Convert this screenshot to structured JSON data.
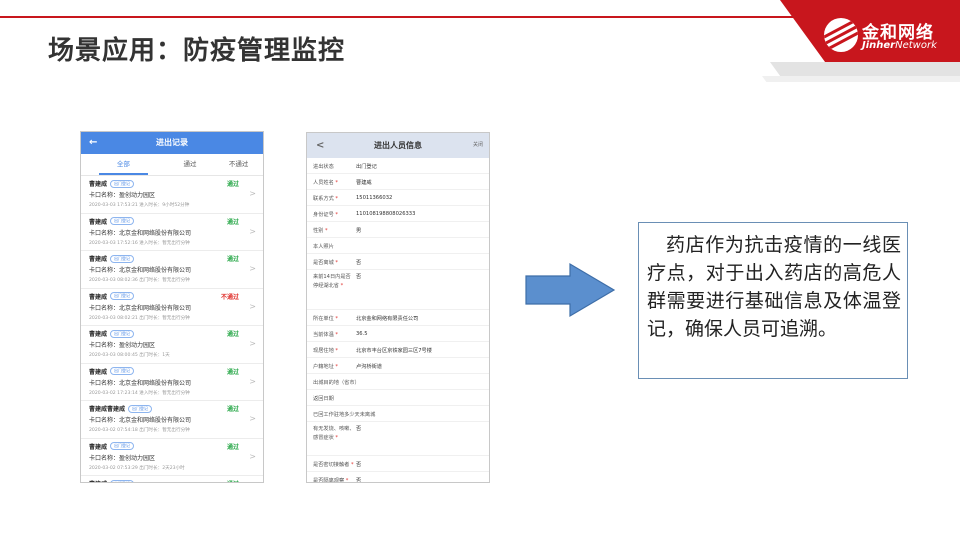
{
  "slide": {
    "title": "场景应用：防疫管理监控",
    "logo_cn": "金和网络",
    "logo_en_bold": "Jinher",
    "logo_en_rest": "Network"
  },
  "records_screen": {
    "title": "进出记录",
    "back": "←",
    "tabs": [
      "全部",
      "通过",
      "不通过"
    ],
    "active_tab": 0,
    "accent": "#4a88e4",
    "records": [
      {
        "name": "曹建威",
        "tag": "出门登记",
        "status": "通过",
        "status_type": "ok",
        "company": "卡口名称：盈创动力园区",
        "meta": "2020-03-03 17:53:21 进入时长：9小时52分钟"
      },
      {
        "name": "曹建威",
        "tag": "出门登记",
        "status": "通过",
        "status_type": "ok",
        "company": "卡口名称：北京金和网络股份有限公司",
        "meta": "2020-03-03 17:52:16 进入时长：暂无出行分钟"
      },
      {
        "name": "曹建威",
        "tag": "出门登记",
        "status": "通过",
        "status_type": "ok",
        "company": "卡口名称：北京金和网络股份有限公司",
        "meta": "2020-03-03 08:02:36 出门时长：暂无出行分钟"
      },
      {
        "name": "曹建威",
        "tag": "出门登记",
        "status": "不通过",
        "status_type": "no",
        "company": "卡口名称：北京金和网络股份有限公司",
        "meta": "2020-03-03 08:02:21 出门时长：暂无出行分钟"
      },
      {
        "name": "曹建威",
        "tag": "出门登记",
        "status": "通过",
        "status_type": "ok",
        "company": "卡口名称：盈创动力园区",
        "meta": "2020-03-03 08:00:45 出门时长：1天"
      },
      {
        "name": "曹建威",
        "tag": "出门登记",
        "status": "通过",
        "status_type": "ok",
        "company": "卡口名称：北京金和网络股份有限公司",
        "meta": "2020-03-02 17:23:14 进入时长：暂无出行分钟"
      },
      {
        "name": "曹建威曹建威",
        "tag": "出门登记",
        "status": "通过",
        "status_type": "ok",
        "company": "卡口名称：北京金和网络股份有限公司",
        "meta": "2020-03-02 07:54:18 出门时长：暂无出行分钟"
      },
      {
        "name": "曹建威",
        "tag": "出门登记",
        "status": "通过",
        "status_type": "ok",
        "company": "卡口名称：盈创动力园区",
        "meta": "2020-03-02 07:53:29 出门时长：2天23小时"
      },
      {
        "name": "曹建威",
        "tag": "出门登记",
        "status": "通过",
        "status_type": "ok",
        "company": "",
        "meta": ""
      }
    ]
  },
  "info_screen": {
    "title": "进出人员信息",
    "back": "<",
    "close": "关闭",
    "fields": [
      {
        "label": "进出状态",
        "value": "出门登记",
        "req": false,
        "kind": "normal"
      },
      {
        "label": "人员姓名",
        "value": "曹建威",
        "req": true,
        "kind": "normal"
      },
      {
        "label": "联系方式",
        "value": "15011366032",
        "req": true,
        "kind": "normal"
      },
      {
        "label": "身份证号",
        "value": "110108198808026333",
        "req": true,
        "kind": "normal"
      },
      {
        "label": "性别",
        "value": "男",
        "req": true,
        "kind": "normal"
      },
      {
        "label": "本人照片",
        "value": "",
        "req": false,
        "kind": "normal"
      },
      {
        "label": "是否离城",
        "value": "否",
        "req": true,
        "kind": "normal"
      },
      {
        "label": "来前14日内是否停经湖北省",
        "value": "否",
        "req": true,
        "kind": "tall"
      },
      {
        "label": "所在单位",
        "value": "北京金和网络有限责任公司",
        "req": true,
        "kind": "normal"
      },
      {
        "label": "当前体温",
        "value": "36.5",
        "req": true,
        "kind": "normal"
      },
      {
        "label": "现居住地",
        "value": "北京市丰台区京铁家园三区7号楼",
        "req": true,
        "kind": "normal"
      },
      {
        "label": "户籍地址",
        "value": "卢沟桥街道",
        "req": true,
        "kind": "normal"
      },
      {
        "label": "出城目的地（省市）",
        "value": "",
        "req": false,
        "kind": "normal"
      },
      {
        "label": "返回日期",
        "value": "",
        "req": false,
        "kind": "normal"
      },
      {
        "label": "已回工作驻地多少天未离城",
        "value": "",
        "req": false,
        "kind": "normal"
      },
      {
        "label": "有无发烧、咳嗽、感冒症状",
        "value": "否",
        "req": true,
        "kind": "mid"
      },
      {
        "label": "是否密切接触者",
        "value": "否",
        "req": true,
        "kind": "normal"
      },
      {
        "label": "是否隔离观察",
        "value": "否",
        "req": true,
        "kind": "normal"
      }
    ]
  },
  "arrow": {
    "fill": "#5b8fce",
    "stroke": "#3e6ea8"
  },
  "description": "药店作为抗击疫情的一线医疗点，对于出入药店的高危人群需要进行基础信息及体温登记，确保人员可追溯。"
}
